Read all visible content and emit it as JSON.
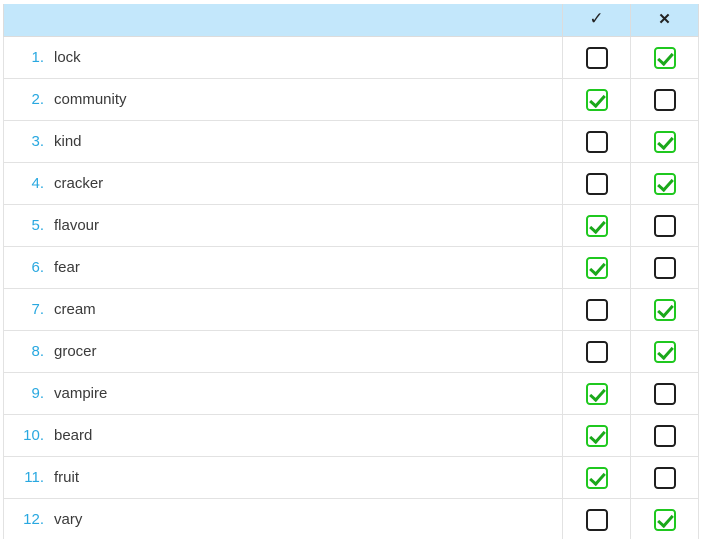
{
  "table": {
    "columns": [
      {
        "key": "word",
        "label": "",
        "icon": ""
      },
      {
        "key": "yes",
        "label": "✓",
        "icon": "check-mark-icon"
      },
      {
        "key": "no",
        "label": "✕",
        "icon": "cross-mark-icon"
      }
    ],
    "header": {
      "word_label": "",
      "yes_label": "✓",
      "no_label": "✕"
    },
    "rows": [
      {
        "num": "1.",
        "word": "lock",
        "yes": false,
        "no": true
      },
      {
        "num": "2.",
        "word": "community",
        "yes": true,
        "no": false
      },
      {
        "num": "3.",
        "word": "kind",
        "yes": false,
        "no": true
      },
      {
        "num": "4.",
        "word": "cracker",
        "yes": false,
        "no": true
      },
      {
        "num": "5.",
        "word": "flavour",
        "yes": true,
        "no": false
      },
      {
        "num": "6.",
        "word": "fear",
        "yes": true,
        "no": false
      },
      {
        "num": "7.",
        "word": "cream",
        "yes": false,
        "no": true
      },
      {
        "num": "8.",
        "word": "grocer",
        "yes": false,
        "no": true
      },
      {
        "num": "9.",
        "word": "vampire",
        "yes": true,
        "no": false
      },
      {
        "num": "10.",
        "word": "beard",
        "yes": true,
        "no": false
      },
      {
        "num": "11.",
        "word": "fruit",
        "yes": true,
        "no": false
      },
      {
        "num": "12.",
        "word": "vary",
        "yes": false,
        "no": true
      }
    ]
  },
  "colors": {
    "header_background": "#c3e7fb",
    "row_number": "#29a8e0",
    "word_text": "#3a3a3a",
    "checkbox_unchecked_border": "#1f1f1f",
    "checkbox_checked_border": "#1fc81f",
    "checkbox_checked_mark": "#1aa81a",
    "grid_line": "#e2e2e2"
  }
}
